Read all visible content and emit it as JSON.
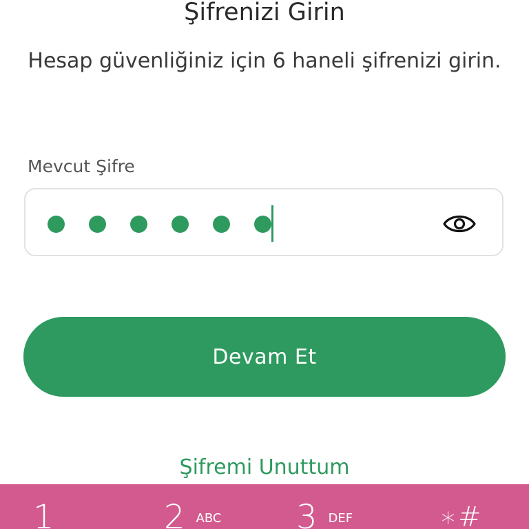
{
  "header": {
    "title": "Şifrenizi Girin",
    "subtitle": "Hesap güvenliğiniz için 6 haneli şifrenizi girin."
  },
  "password_field": {
    "label": "Mevcut Şifre",
    "entered_length": 6,
    "max_length": 6,
    "visibility_icon": "eye-icon"
  },
  "actions": {
    "continue_label": "Devam Et",
    "forgot_label": "Şifremi Unuttum"
  },
  "keypad": {
    "keys": [
      {
        "num": "1",
        "letters": ""
      },
      {
        "num": "2",
        "letters": "ABC"
      },
      {
        "num": "3",
        "letters": "DEF"
      },
      {
        "num": "∗#",
        "letters": ""
      }
    ]
  },
  "colors": {
    "accent": "#2e9a5f",
    "keypad": "#d35a8e"
  }
}
